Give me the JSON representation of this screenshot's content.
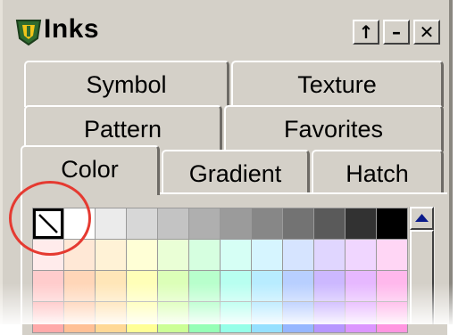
{
  "window": {
    "title": "Inks",
    "icon": "inks-app-icon",
    "buttons": [
      {
        "name": "restore-button",
        "icon": "arrow-up-icon",
        "glyph": "↑"
      },
      {
        "name": "minimize-button",
        "icon": "minimize-icon",
        "glyph": "–"
      },
      {
        "name": "close-button",
        "icon": "close-icon",
        "glyph": "✕"
      }
    ]
  },
  "tabs": {
    "row1": [
      "Symbol",
      "Texture"
    ],
    "row2": [
      "Pattern",
      "Favorites"
    ],
    "row3": [
      "Color",
      "Gradient",
      "Hatch"
    ],
    "active": "Color"
  },
  "palette": {
    "none_swatch": "no-color",
    "rows": [
      [
        "none",
        "#ffffff",
        "#ebebeb",
        "#d7d7d7",
        "#c3c3c3",
        "#afafaf",
        "#9b9b9b",
        "#878787",
        "#737373",
        "#5a5a5a",
        "#323232",
        "#000000"
      ],
      [
        "#ffebeb",
        "#ffe8d6",
        "#fff2d6",
        "#ffffd6",
        "#eaffd6",
        "#d6ffe0",
        "#d6fff5",
        "#d6f5ff",
        "#d6e4ff",
        "#e0d6ff",
        "#f0d6ff",
        "#ffd6f5"
      ],
      [
        "#ffcccc",
        "#ffd6b8",
        "#ffe6b8",
        "#ffffb8",
        "#dcffb8",
        "#b8ffcc",
        "#b8fff0",
        "#b8ecff",
        "#b8cfff",
        "#ccb8ff",
        "#e6b8ff",
        "#ffb8ec"
      ],
      [
        "#ffaaaa",
        "#ffc096",
        "#ffd896",
        "#ffff96",
        "#ccff96",
        "#96ffb6",
        "#96ffe8",
        "#96e0ff",
        "#96b6ff",
        "#b696ff",
        "#dc96ff",
        "#ff96e0"
      ]
    ]
  },
  "colors": {
    "panel": "#d4d0c8",
    "highlight_circle": "#e53a31",
    "scroll_arrow": "#0a1a8a"
  }
}
